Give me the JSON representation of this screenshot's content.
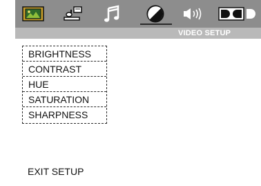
{
  "header": {
    "section_title": "VIDEO SETUP",
    "active_tab": "video",
    "tabs": [
      {
        "id": "general",
        "icon": "tv-screen-icon"
      },
      {
        "id": "speaker",
        "icon": "speaker-setup-icon"
      },
      {
        "id": "audio",
        "icon": "music-note-icon"
      },
      {
        "id": "video",
        "icon": "contrast-dial-icon"
      },
      {
        "id": "sound",
        "icon": "speaker-sound-icon"
      },
      {
        "id": "dolby",
        "icon": "dolby-digital-icon"
      }
    ]
  },
  "menu": {
    "items": [
      {
        "label": "BRIGHTNESS"
      },
      {
        "label": "CONTRAST"
      },
      {
        "label": "HUE"
      },
      {
        "label": "SATURATION"
      },
      {
        "label": "SHARPNESS"
      }
    ]
  },
  "footer": {
    "exit_label": "EXIT SETUP"
  },
  "colors": {
    "header_bar": "#8d8d8d",
    "sub_bar": "#b9b9b9",
    "section_title_text": "#ffffff",
    "general_icon_frame": "#c8a02a",
    "general_icon_screen": "#2f6b2a"
  }
}
